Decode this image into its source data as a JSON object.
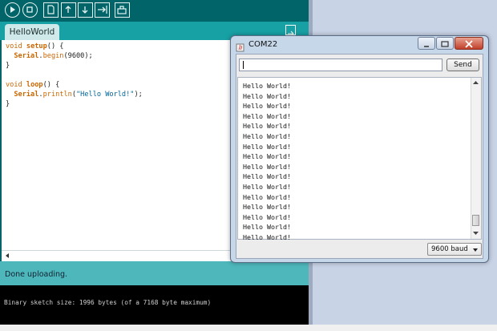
{
  "ide": {
    "toolbar": {
      "buttons": [
        {
          "name": "verify-icon"
        },
        {
          "name": "stop-icon"
        },
        {
          "name": "new-icon"
        },
        {
          "name": "open-icon"
        },
        {
          "name": "save-icon"
        },
        {
          "name": "upload-icon"
        },
        {
          "name": "serial-monitor-icon"
        }
      ]
    },
    "tab_label": "HelloWorld",
    "code_lines": [
      "void setup() {",
      "  Serial.begin(9600);",
      "}",
      "",
      "void loop() {",
      "  Serial.println(\"Hello World!\");",
      "}"
    ],
    "status": "Done uploading.",
    "console": "Binary sketch size: 1996 bytes (of a 7168 byte maximum)",
    "colors": {
      "toolbar": "#006468",
      "tabbar": "#17a1a5",
      "status": "#4db7bb",
      "keyword": "#cc6600",
      "string": "#006699"
    }
  },
  "serial_monitor": {
    "title": "COM22",
    "input_value": "",
    "send_label": "Send",
    "output_lines": [
      "Hello World!",
      "Hello World!",
      "Hello World!",
      "Hello World!",
      "Hello World!",
      "Hello World!",
      "Hello World!",
      "Hello World!",
      "Hello World!",
      "Hello World!",
      "Hello World!",
      "Hello World!",
      "Hello World!",
      "Hello World!",
      "Hello World!",
      "Hello World!"
    ],
    "baud": "9600 baud"
  }
}
